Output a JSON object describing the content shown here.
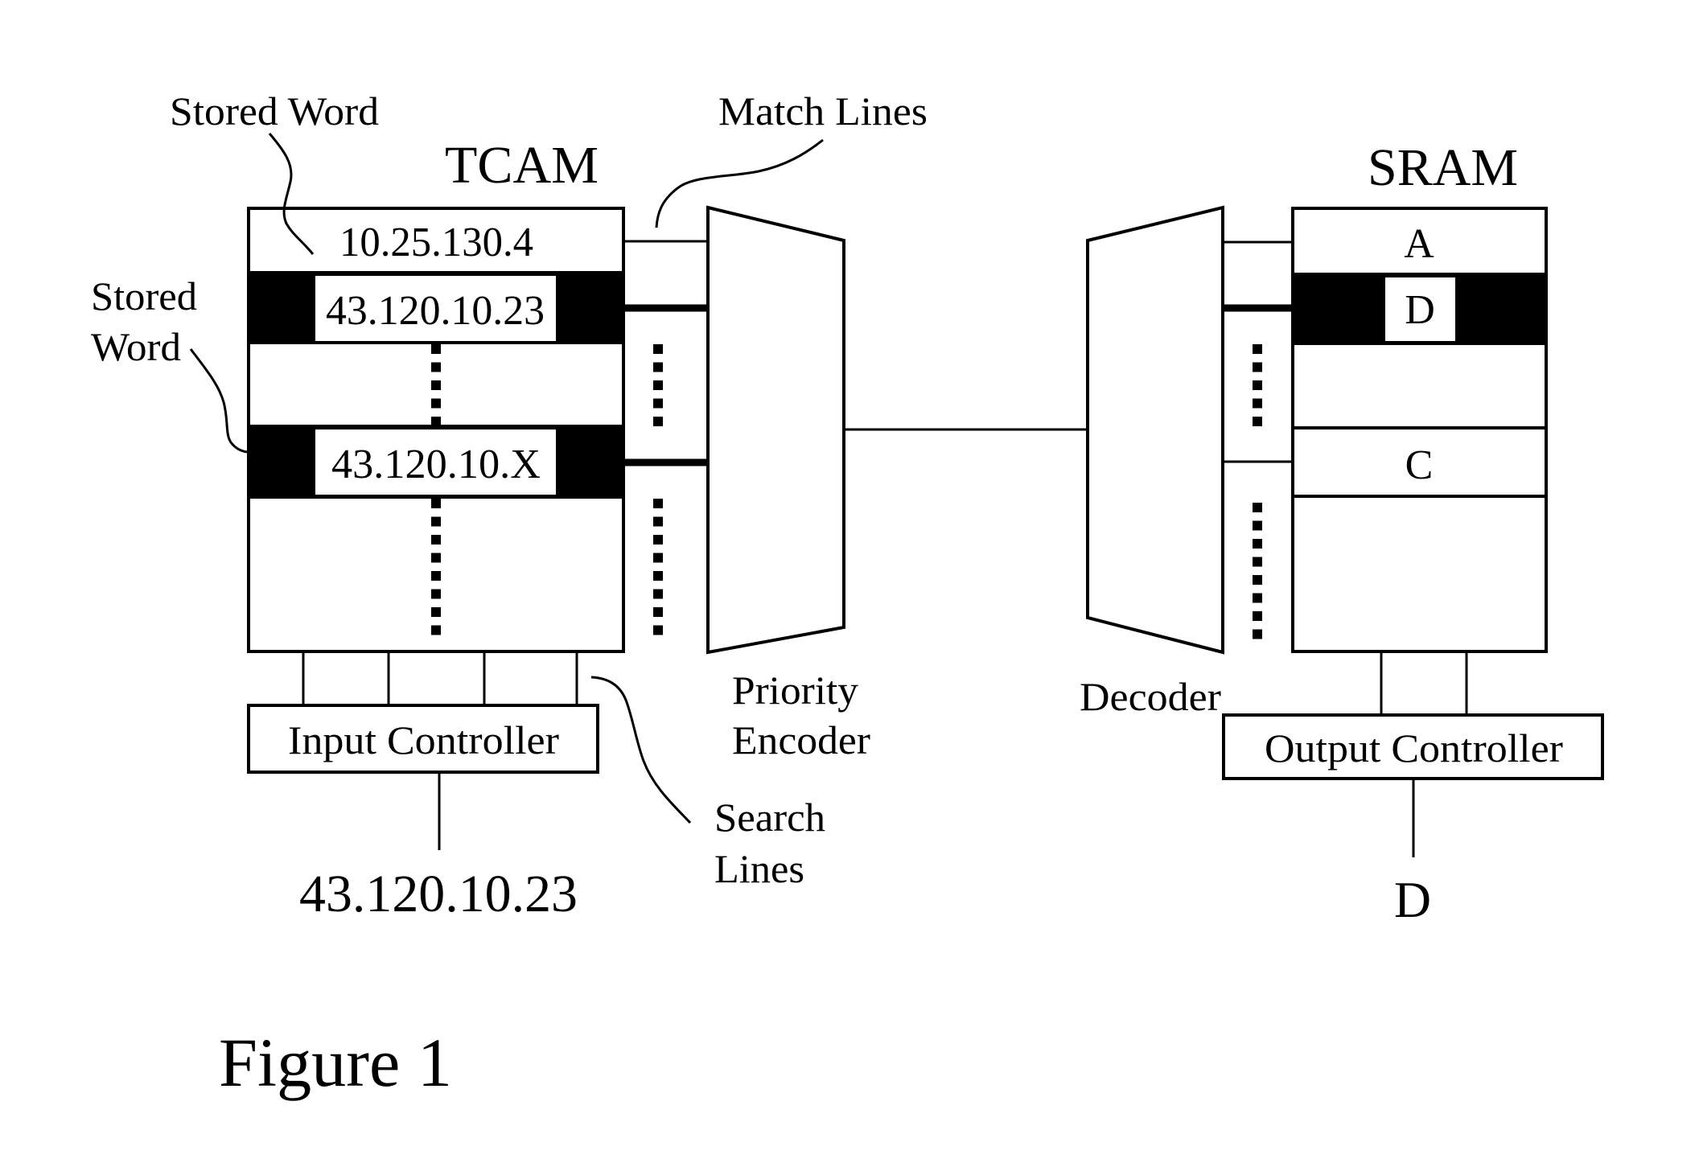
{
  "figure": {
    "caption": "Figure 1",
    "colors": {
      "ink": "#000000",
      "paper": "#ffffff"
    }
  },
  "tcam": {
    "title": "TCAM",
    "rows": [
      {
        "value": "10.25.130.4",
        "highlighted": false
      },
      {
        "value": "43.120.10.23",
        "highlighted": true
      },
      {
        "value": "",
        "highlighted": false
      },
      {
        "value": "43.120.10.X",
        "highlighted": true
      },
      {
        "value": "",
        "highlighted": false
      }
    ]
  },
  "sram": {
    "title": "SRAM",
    "rows": [
      {
        "value": "A",
        "highlighted": false
      },
      {
        "value": "D",
        "highlighted": true
      },
      {
        "value": "",
        "highlighted": false
      },
      {
        "value": "C",
        "highlighted": false
      },
      {
        "value": "",
        "highlighted": false
      }
    ]
  },
  "labels": {
    "stored_word_top": "Stored Word",
    "stored_word_left_line1": "Stored",
    "stored_word_left_line2": "Word",
    "match_lines": "Match Lines",
    "priority_encoder_line1": "Priority",
    "priority_encoder_line2": "Encoder",
    "decoder": "Decoder",
    "search_lines_line1": "Search",
    "search_lines_line2": "Lines"
  },
  "input_controller": {
    "label": "Input Controller",
    "search_key": "43.120.10.23"
  },
  "output_controller": {
    "label": "Output Controller",
    "result": "D"
  }
}
